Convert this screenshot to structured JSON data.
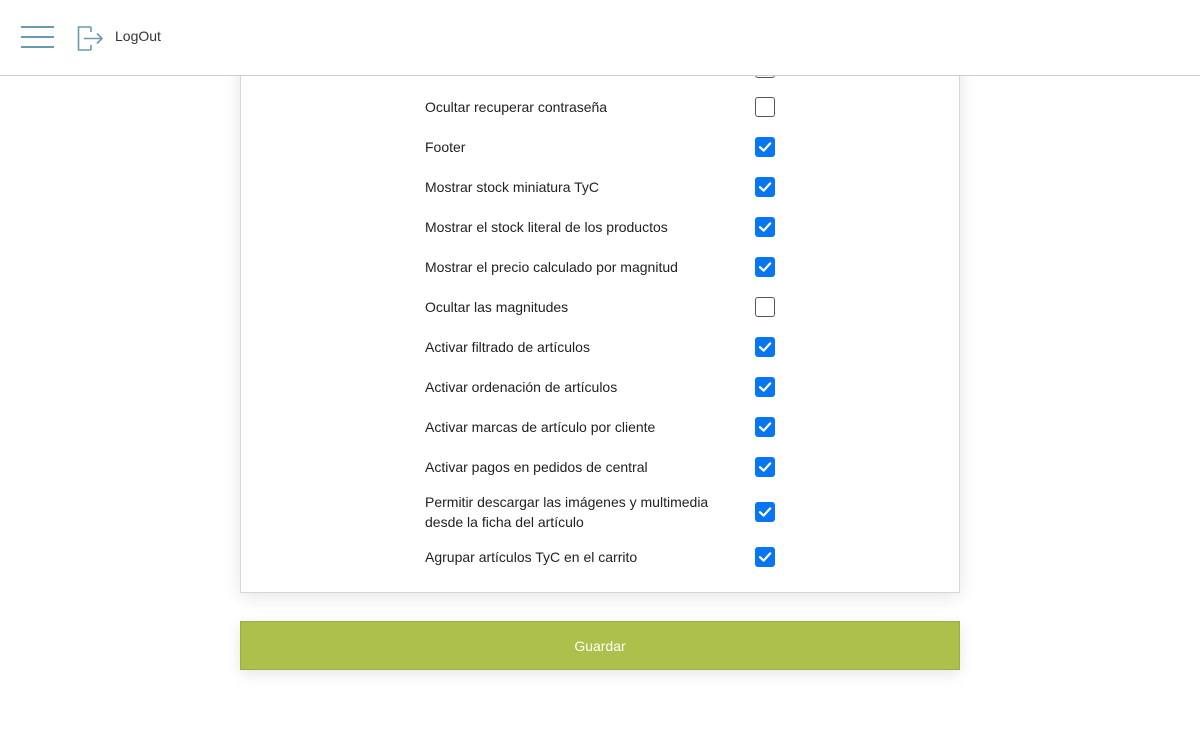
{
  "header": {
    "logout_label": "LogOut"
  },
  "settings": {
    "options": [
      {
        "label": "Ocultar recuperar contraseña",
        "checked": false
      },
      {
        "label": "Footer",
        "checked": true
      },
      {
        "label": "Mostrar stock miniatura TyC",
        "checked": true
      },
      {
        "label": "Mostrar el stock literal de los productos",
        "checked": true
      },
      {
        "label": "Mostrar el precio calculado por magnitud",
        "checked": true
      },
      {
        "label": "Ocultar las magnitudes",
        "checked": false
      },
      {
        "label": "Activar filtrado de artículos",
        "checked": true
      },
      {
        "label": "Activar ordenación de artículos",
        "checked": true
      },
      {
        "label": "Activar marcas de artículo por cliente",
        "checked": true
      },
      {
        "label": "Activar pagos en pedidos de central",
        "checked": true
      },
      {
        "label": "Permitir descargar las imágenes y multimedia desde la ficha del artículo",
        "checked": true
      },
      {
        "label": "Agrupar artículos TyC en el carrito",
        "checked": true
      }
    ]
  },
  "footer": {
    "save_label": "Guardar"
  },
  "colors": {
    "accent": "#0a75f0",
    "save_button": "#adc04b",
    "icon": "#6a9ab0"
  },
  "icons": {
    "menu": "hamburger-menu-icon",
    "logout": "logout-icon",
    "check": "checkmark-icon"
  }
}
